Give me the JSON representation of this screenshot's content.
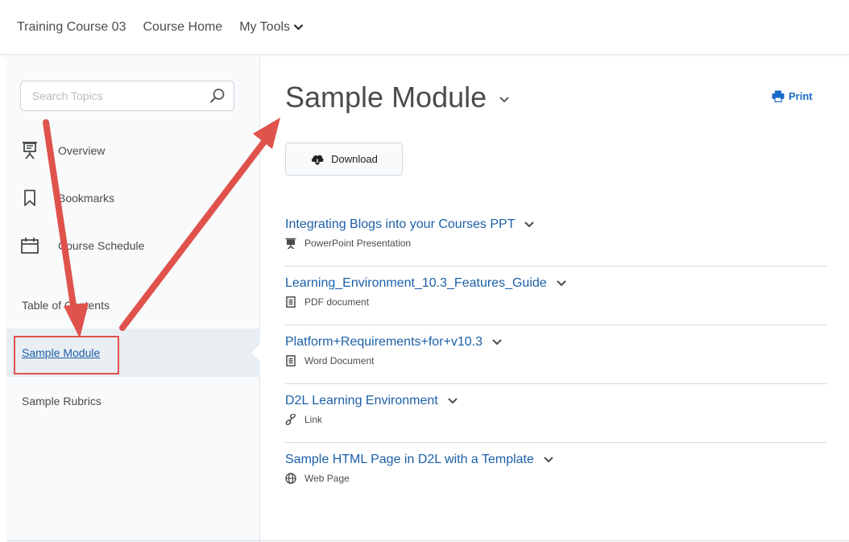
{
  "topnav": {
    "course_name": "Training Course 03",
    "course_home": "Course Home",
    "my_tools": "My Tools"
  },
  "sidebar": {
    "search_placeholder": "Search Topics",
    "items": [
      {
        "label": "Overview",
        "icon": "presentation-icon"
      },
      {
        "label": "Bookmarks",
        "icon": "bookmark-icon"
      },
      {
        "label": "Course Schedule",
        "icon": "calendar-icon"
      }
    ],
    "toc_label": "Table of Contents",
    "toc": [
      {
        "label": "Sample Module",
        "active": true
      },
      {
        "label": "Sample Rubrics",
        "active": false
      }
    ]
  },
  "main": {
    "title": "Sample Module",
    "print_label": "Print",
    "download_label": "Download",
    "items": [
      {
        "title": "Integrating Blogs into your Courses PPT",
        "type": "PowerPoint Presentation",
        "icon": "powerpoint-icon"
      },
      {
        "title": "Learning_Environment_10.3_Features_Guide",
        "type": "PDF document",
        "icon": "document-icon"
      },
      {
        "title": "Platform+Requirements+for+v10.3",
        "type": "Word Document",
        "icon": "document-icon"
      },
      {
        "title": "D2L Learning Environment",
        "type": "Link",
        "icon": "link-icon"
      },
      {
        "title": "Sample HTML Page in D2L with a Template",
        "type": "Web Page",
        "icon": "globe-icon"
      }
    ]
  },
  "colors": {
    "link": "#1b5fa8",
    "annotation": "#e0524c",
    "text": "#494c4e"
  }
}
